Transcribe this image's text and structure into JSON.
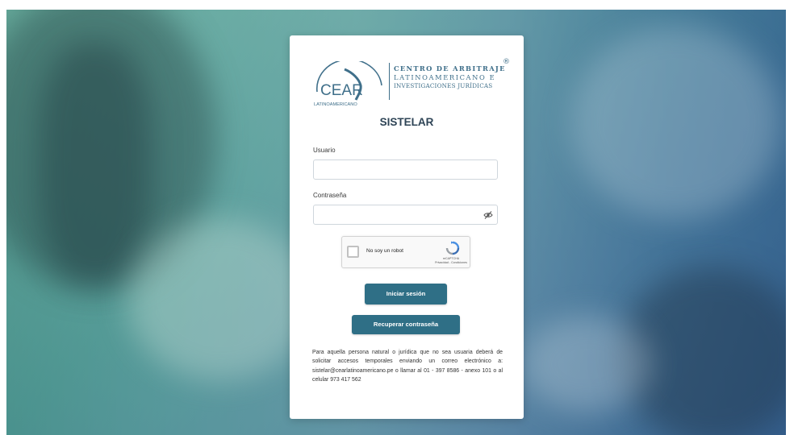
{
  "brand": {
    "logo_initials": "CEAR",
    "logo_subtitle": "LATINOAMERICANO",
    "line1": "CENTRO DE ARBITRAJE",
    "line2": "LATINOAMERICANO E",
    "line3": "INVESTIGACIONES JURÍDICAS",
    "registered": "®",
    "color": "#3f6f8a"
  },
  "login": {
    "title": "SISTELAR",
    "username_label": "Usuario",
    "username_value": "",
    "password_label": "Contraseña",
    "password_value": "",
    "toggle_icon": "eye-slash-icon"
  },
  "captcha": {
    "label": "No soy un robot",
    "brand": "reCAPTCHA",
    "links": "Privacidad - Condiciones",
    "icon": "recaptcha-icon"
  },
  "actions": {
    "login_label": "Iniciar sesión",
    "recover_label": "Recuperar contraseña",
    "button_color": "#2f6f86"
  },
  "info_text": "Para aquella persona natural o jurídica que no sea usuaria deberá de solicitar accesos temporales enviando un correo electrónico a: sistelar@cearlatinoamericano.pe o llamar al 01 - 397 8586 - anexo 101 o al celular 973 417 562"
}
